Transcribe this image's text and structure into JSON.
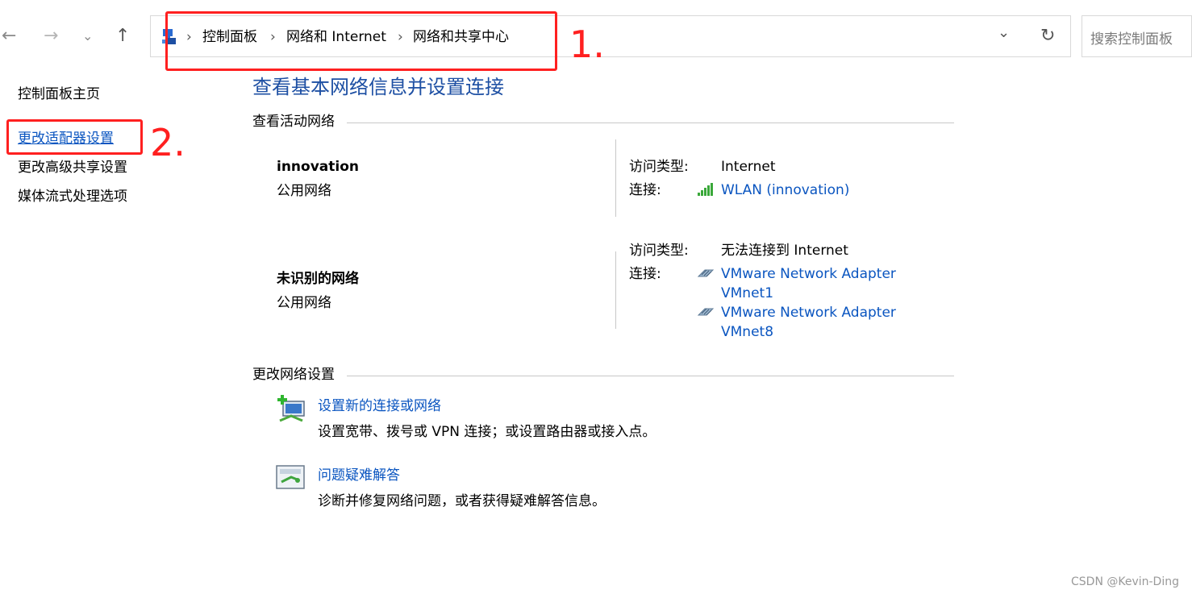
{
  "nav": {
    "back": "←",
    "forward": "→",
    "recent": "⌄",
    "up": "↑"
  },
  "address": {
    "crumbs": [
      "控制面板",
      "网络和 Internet",
      "网络和共享中心"
    ],
    "separator": "›",
    "dropdown": "⌄",
    "refresh": "↻"
  },
  "search": {
    "placeholder": "搜索控制面板"
  },
  "annotations": {
    "step1": "1.",
    "step2": "2.",
    "color": "#ff2020"
  },
  "sidebar": {
    "items": [
      "控制面板主页",
      "更改适配器设置",
      "更改高级共享设置",
      "媒体流式处理选项"
    ]
  },
  "main": {
    "title": "查看基本网络信息并设置连接",
    "active_section": "查看活动网络",
    "networks": [
      {
        "name": "innovation",
        "type": "公用网络",
        "access_label": "访问类型:",
        "access_value": "Internet",
        "connection_label": "连接:",
        "connections": [
          "WLAN (innovation)"
        ]
      },
      {
        "name": "未识别的网络",
        "type": "公用网络",
        "access_label": "访问类型:",
        "access_value": "无法连接到 Internet",
        "connection_label": "连接:",
        "connections": [
          {
            "line1": "VMware Network Adapter",
            "line2": "VMnet1"
          },
          {
            "line1": "VMware Network Adapter",
            "line2": "VMnet8"
          }
        ]
      }
    ],
    "change_section": "更改网络设置",
    "tasks": [
      {
        "title": "设置新的连接或网络",
        "desc": "设置宽带、拨号或 VPN 连接；或设置路由器或接入点。"
      },
      {
        "title": "问题疑难解答",
        "desc": "诊断并修复网络问题，或者获得疑难解答信息。"
      }
    ]
  },
  "footer": "CSDN @Kevin-Ding",
  "colors": {
    "link": "#0a55c0",
    "title": "#1d4fa3"
  }
}
